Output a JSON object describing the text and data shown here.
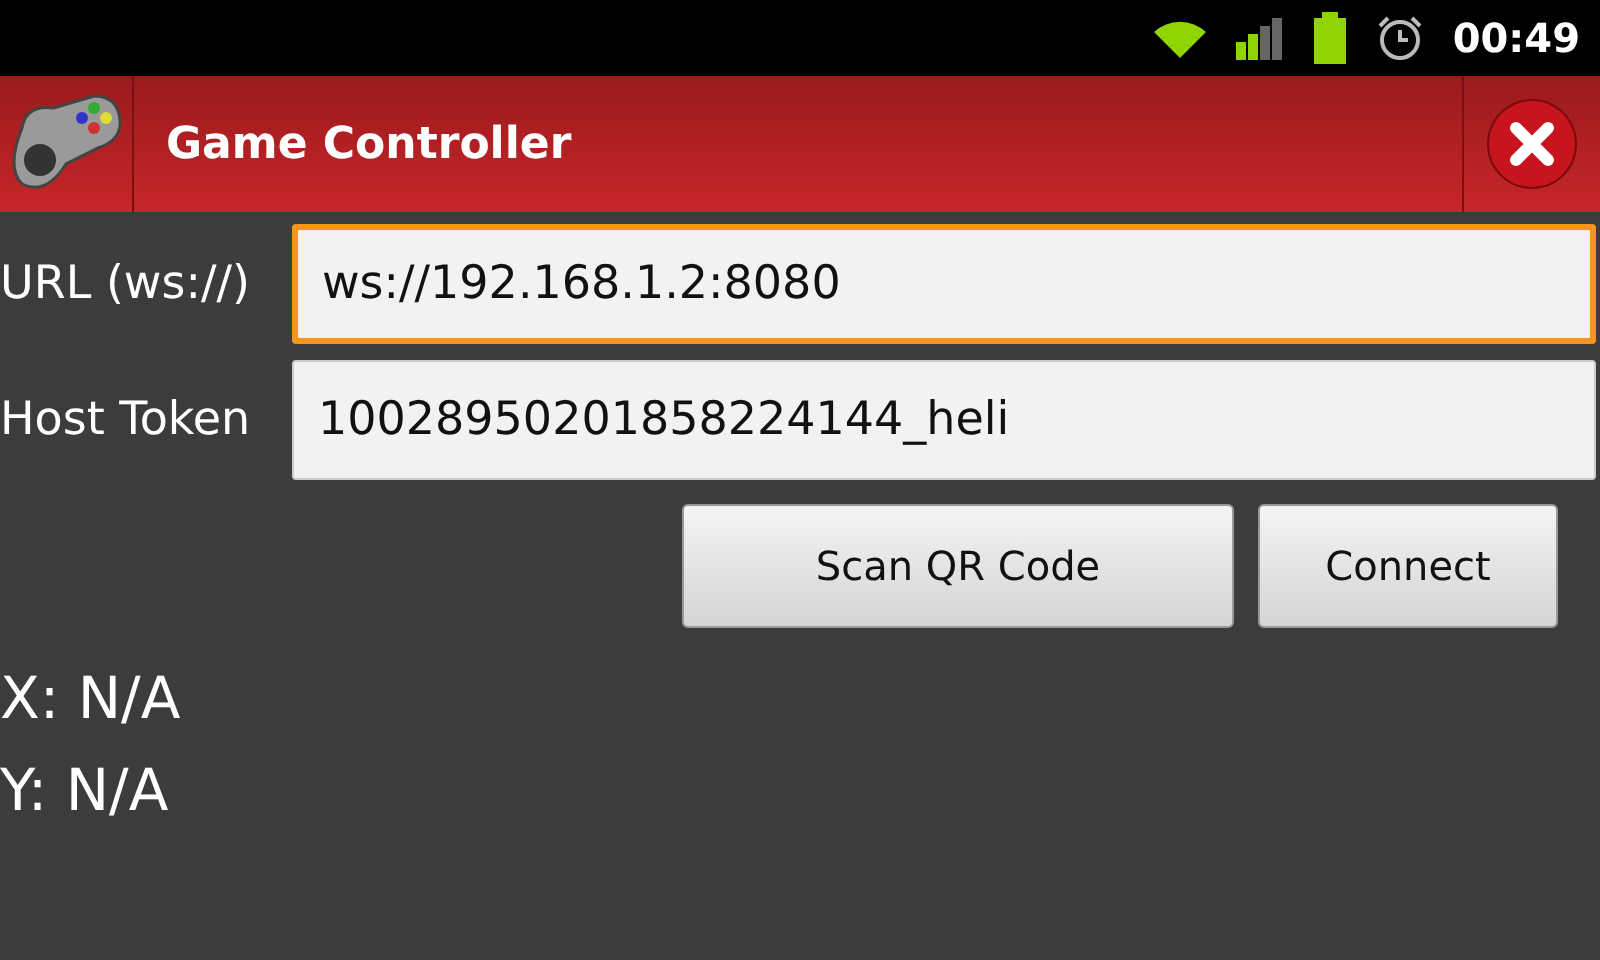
{
  "status_bar": {
    "time": "00:49"
  },
  "app_bar": {
    "title": "Game Controller"
  },
  "fields": [
    {
      "label": "URL (ws://)",
      "value": "ws://192.168.1.2:8080",
      "focused": true
    },
    {
      "label": "Host Token",
      "value": "10028950201858224144_heli",
      "focused": false
    }
  ],
  "buttons": [
    "Scan QR Code",
    "Connect"
  ],
  "readouts": [
    "X: N/A",
    "Y: N/A"
  ]
}
